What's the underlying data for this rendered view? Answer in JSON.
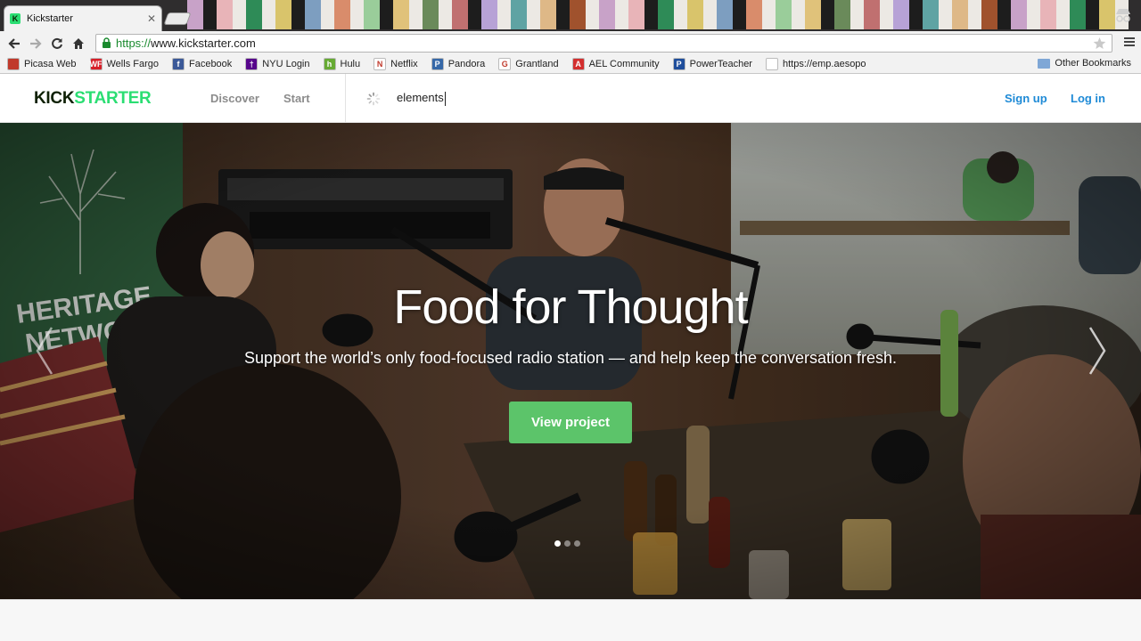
{
  "browser": {
    "tab_title": "Kickstarter",
    "tab_close": "✕",
    "url_scheme": "https://",
    "url_rest": "www.kickstarter.com",
    "favicon_letter": "K"
  },
  "bookmarks": {
    "items": [
      {
        "label": "Picasa Web",
        "icon": "picasa-icon",
        "color": "#c0392b",
        "letter": ""
      },
      {
        "label": "Wells Fargo",
        "icon": "wells-fargo-icon",
        "color": "#d71e28",
        "letter": "WF"
      },
      {
        "label": "Facebook",
        "icon": "facebook-icon",
        "color": "#3b5998",
        "letter": "f"
      },
      {
        "label": "NYU Login",
        "icon": "nyu-icon",
        "color": "#57068c",
        "letter": "†"
      },
      {
        "label": "Hulu",
        "icon": "hulu-icon",
        "color": "#66aa33",
        "letter": "h"
      },
      {
        "label": "Netflix",
        "icon": "netflix-icon",
        "color": "#ffffff",
        "letter": "N"
      },
      {
        "label": "Pandora",
        "icon": "pandora-icon",
        "color": "#3668a8",
        "letter": "P"
      },
      {
        "label": "Grantland",
        "icon": "grantland-icon",
        "color": "#ffffff",
        "letter": "G"
      },
      {
        "label": "AEL Community",
        "icon": "ael-icon",
        "color": "#d32f2f",
        "letter": "A"
      },
      {
        "label": "PowerTeacher",
        "icon": "powerteacher-icon",
        "color": "#1f4e9c",
        "letter": "P"
      },
      {
        "label": "https://emp.aesopo",
        "icon": "aesop-icon",
        "color": "#ffffff",
        "letter": ""
      }
    ],
    "other": "Other Bookmarks"
  },
  "nav": {
    "logo_part1": "KICK",
    "logo_part2": "STARTER",
    "discover": "Discover",
    "start": "Start",
    "search_value": "elements",
    "signup": "Sign up",
    "login": "Log in"
  },
  "hero": {
    "title": "Food for Thought",
    "subtitle": "Support the world’s only food-focused radio station — and help keep the conversation fresh.",
    "cta": "View project",
    "slide_count": 3,
    "active_slide": 1
  },
  "colors": {
    "brand_green": "#2bde73",
    "brand_dark": "#0f2105",
    "cta_green": "#5cc46a",
    "link_blue": "#1e8ad6"
  }
}
